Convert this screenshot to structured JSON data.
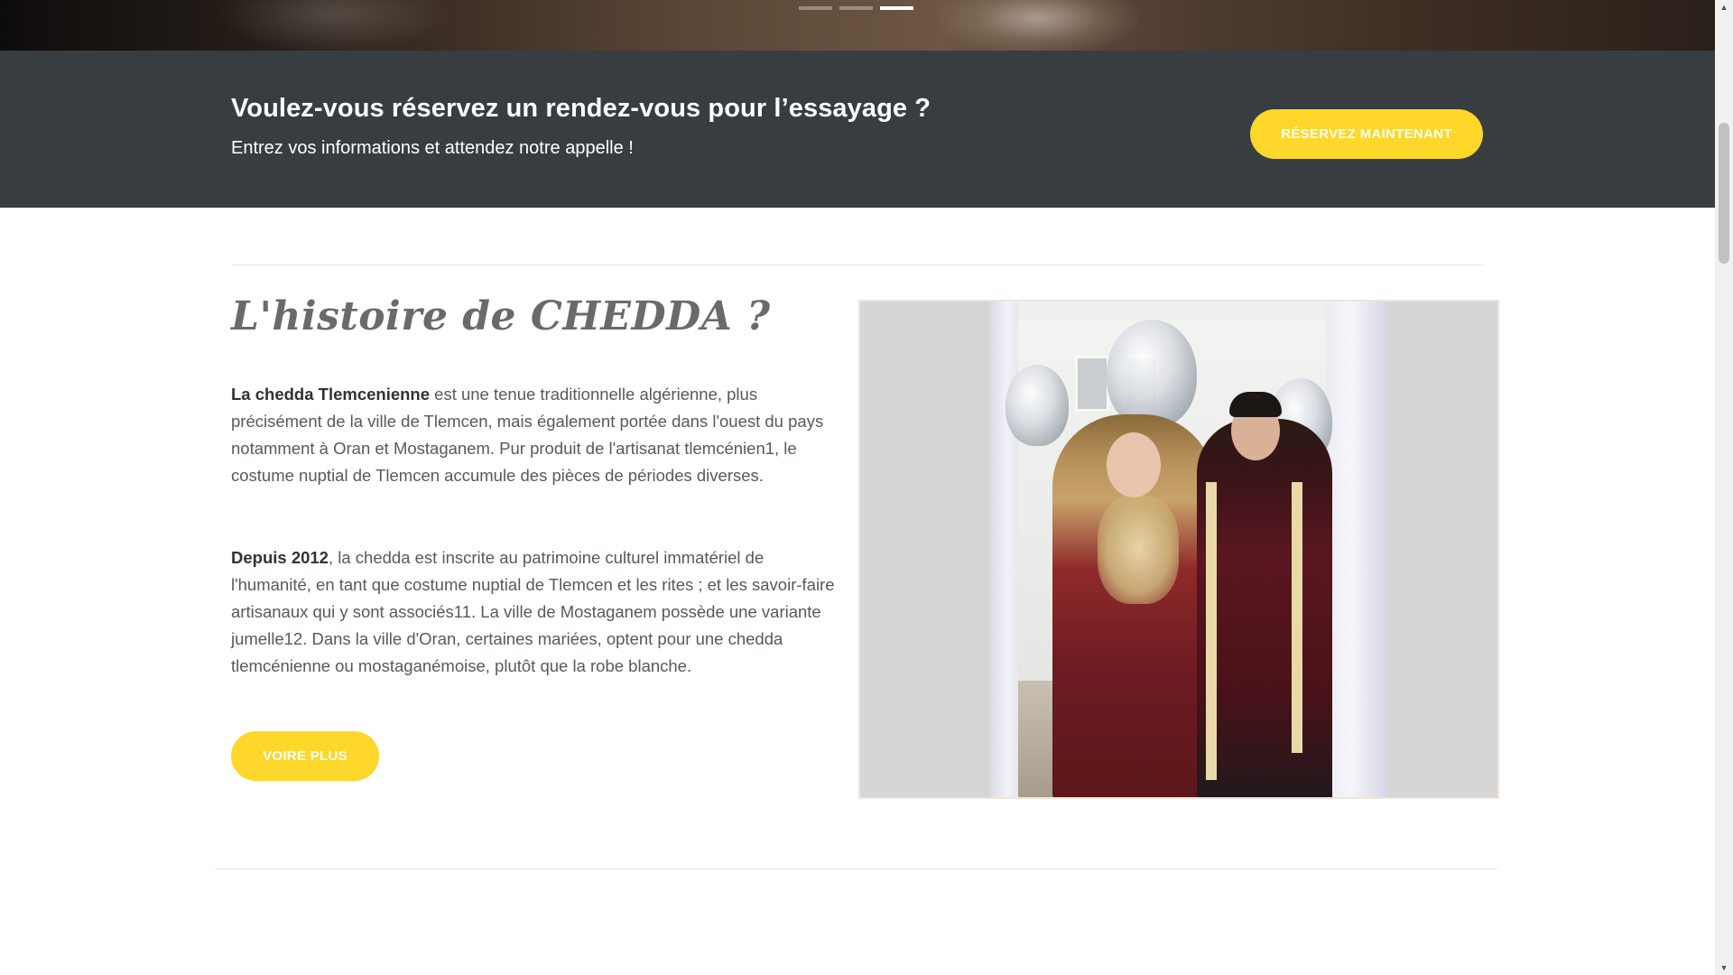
{
  "hero": {
    "slide_count": 3,
    "active_slide": 3
  },
  "cta": {
    "title": "Voulez-vous réservez un rendez-vous pour l’essayage ?",
    "subtitle": "Entrez vos informations et attendez notre appelle !",
    "button_label": "RÉSERVEZ MAINTENANT"
  },
  "story": {
    "title": "L'histoire de CHEDDA ?",
    "p1_strong": "La chedda Tlemcenienne",
    "p1_rest": " est une tenue traditionnelle algérienne, plus précisément de la ville de Tlemcen, mais également portée dans l'ouest du pays notamment à Oran et Mostaganem. Pur produit de l'artisanat tlemcénien1, le costume nuptial de Tlemcen accumule des pièces de périodes diverses.",
    "p2_strong": "Depuis 2012",
    "p2_rest": ", la chedda est inscrite au patrimoine culturel immatériel de l'humanité, en tant que costume nuptial de Tlemcen et les rites ; et les savoir-faire artisanaux qui y sont associés11. La ville de Mostaganem possède une variante jumelle12. Dans la ville d'Oran, certaines mariées, optent pour une chedda tlemcénienne ou mostaganémoise, plutôt que la robe blanche.",
    "button_label": "VOIRE PLUS"
  },
  "colors": {
    "accent": "#fdd72a",
    "cta_background": "#383d42",
    "text": "#555a5e"
  },
  "icons": {
    "scroll_up": "triangle-up-icon",
    "scroll_down": "triangle-down-icon"
  }
}
